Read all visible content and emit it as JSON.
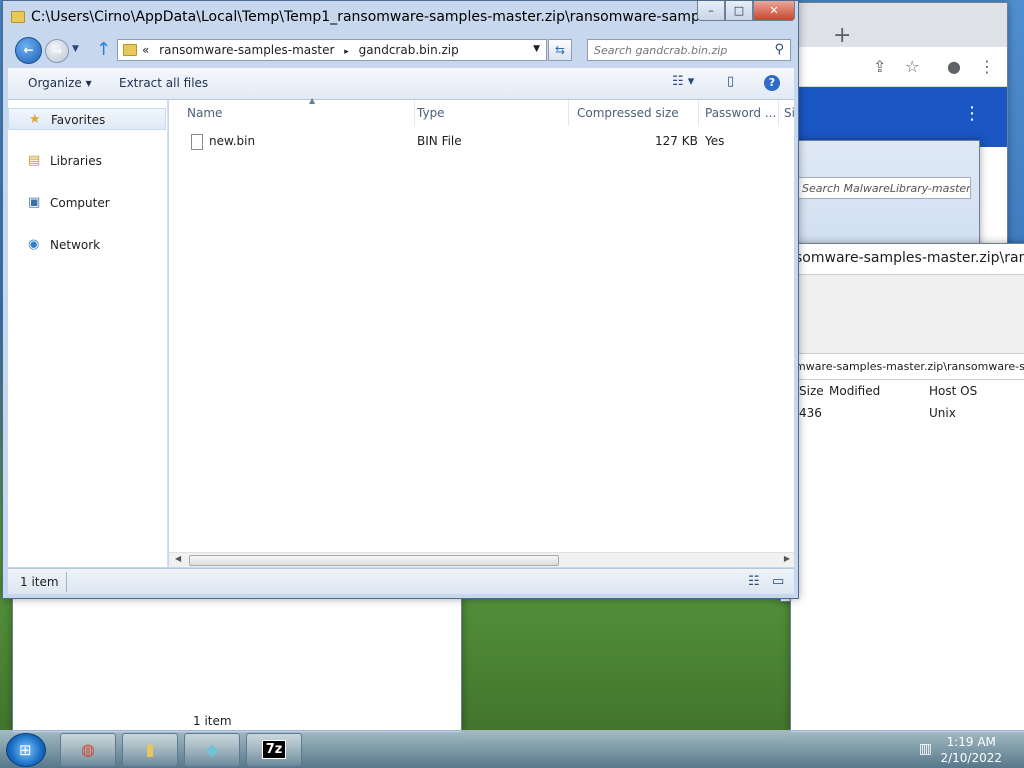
{
  "main_window": {
    "title": "C:\\Users\\Cirno\\AppData\\Local\\Temp\\Temp1_ransomware-samples-master.zip\\ransomware-samples...",
    "caption": {
      "minimize": "–",
      "maximize": "□",
      "close": "✕"
    },
    "address": {
      "prefix": "«",
      "crumbs": [
        "ransomware-samples-master",
        "gandcrab.bin.zip"
      ],
      "separator": "▸"
    },
    "search": {
      "placeholder": "Search gandcrab.bin.zip"
    },
    "commands": {
      "organize": "Organize",
      "extract_all": "Extract all files"
    },
    "nav_pane": [
      {
        "label": "Favorites",
        "icon": "star-icon",
        "glyph": "★"
      },
      {
        "label": "Libraries",
        "icon": "libraries-icon",
        "glyph": "▤"
      },
      {
        "label": "Computer",
        "icon": "computer-icon",
        "glyph": "▣"
      },
      {
        "label": "Network",
        "icon": "network-icon",
        "glyph": "◉"
      }
    ],
    "columns": {
      "name": "Name",
      "type": "Type",
      "compressed_size": "Compressed size",
      "password": "Password ...",
      "size": "Si"
    },
    "files": [
      {
        "name": "new.bin",
        "type": "BIN File",
        "compressed_size": "127 KB",
        "password": "Yes"
      }
    ],
    "status": {
      "item_count": "1 item"
    }
  },
  "background_7zip": {
    "title": "somware-samples-master.zip\\rans",
    "path": "mware-samples-master.zip\\ransomware-sar",
    "columns": {
      "size": "Size",
      "modified": "Modified",
      "host_os": "Host OS"
    },
    "row": {
      "size": "436",
      "modified": "",
      "host_os": "Unix"
    }
  },
  "background_explorer": {
    "search_placeholder": "Search MalwareLibrary-master..."
  },
  "background_lower_explorer": {
    "status": "1 item"
  },
  "taskbar": {
    "start_glyph": "⊞",
    "apps": [
      {
        "name": "Google Chrome",
        "glyph": "◍"
      },
      {
        "name": "Windows Explorer",
        "glyph": "▮"
      },
      {
        "name": "Application",
        "glyph": "◆"
      },
      {
        "name": "7-Zip",
        "glyph": "7z"
      }
    ],
    "time": "1:19 AM",
    "date": "2/10/2022"
  },
  "colors": {
    "accent": "#2d6bc6",
    "close_button": "#c8462e",
    "chrome_blue": "#1a56c4"
  }
}
